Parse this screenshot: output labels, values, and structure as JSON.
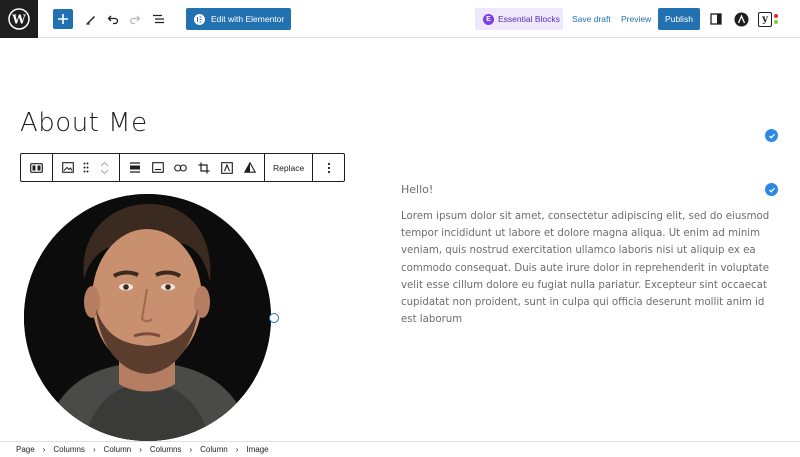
{
  "toolbar": {
    "elementor_label": "Edit with Elementor",
    "essential_blocks_label": "Essential Blocks",
    "save_draft_label": "Save draft",
    "preview_label": "Preview",
    "publish_label": "Publish",
    "yoast_label": "y"
  },
  "content": {
    "title": "About Me",
    "hello": "Hello!",
    "paragraph": "Lorem ipsum dolor sit amet, consectetur adipiscing elit, sed do eiusmod tempor incididunt ut labore et dolore magna aliqua. Ut enim ad minim veniam, quis nostrud exercitation ullamco laboris nisi ut aliquip ex ea commodo consequat. Duis aute irure dolor in reprehenderit in voluptate velit esse cillum dolore eu fugiat nulla pariatur. Excepteur sint occaecat cupidatat non proident, sunt in culpa qui officia deserunt mollit anim id est laborum"
  },
  "block_toolbar": {
    "replace_label": "Replace"
  },
  "breadcrumb": {
    "items": [
      "Page",
      "Columns",
      "Column",
      "Columns",
      "Column",
      "Image"
    ]
  },
  "colors": {
    "accent": "#2271b1",
    "check": "#2b89e5",
    "essential_blocks_bg": "#efe7fb"
  }
}
